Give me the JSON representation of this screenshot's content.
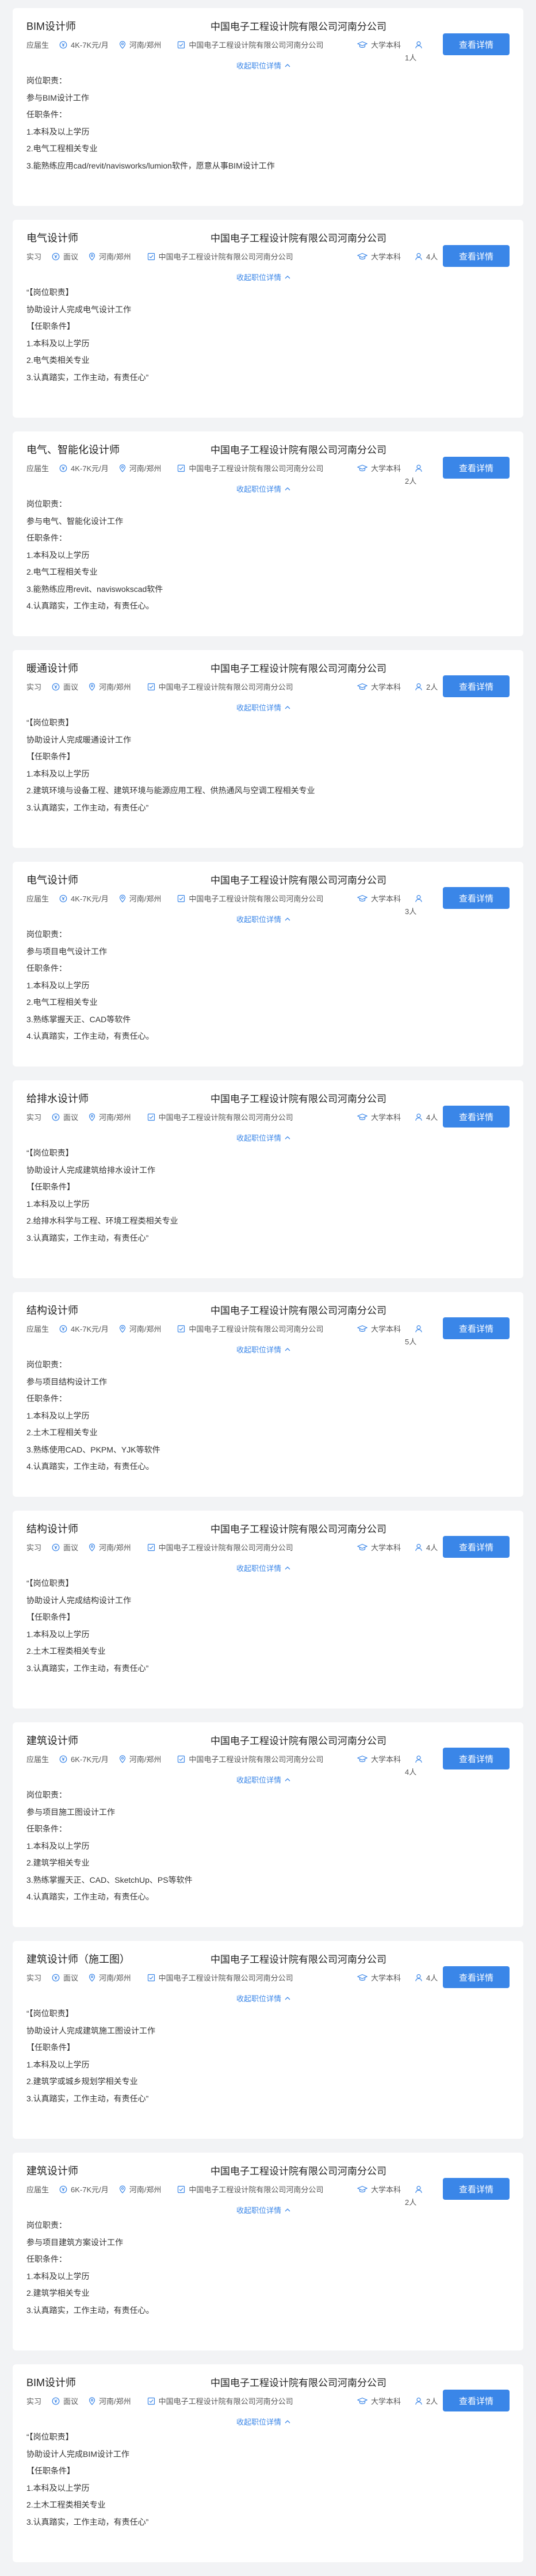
{
  "collapse_label": "收起职位详情",
  "detail_button_label": "查看详情",
  "jobs": [
    {
      "title": "BIM设计师",
      "company": "中国电子工程设计院有限公司河南分公司",
      "type": "应届生",
      "salary": "4K-7K元/月",
      "location": "河南/郑州",
      "company_short": "中国电子工程设计院有限公司河南分公司",
      "education": "大学本科",
      "headcount": "1人",
      "desc": [
        "岗位职责：",
        "参与BIM设计工作",
        "任职条件：",
        "1.本科及以上学历",
        "2.电气工程相关专业",
        "3.能熟练应用cad/revit/navisworks/lumion软件，愿意从事BIM设计工作"
      ]
    },
    {
      "title": "电气设计师",
      "company": "中国电子工程设计院有限公司河南分公司",
      "type": "实习",
      "salary": "面议",
      "location": "河南/郑州",
      "company_short": "中国电子工程设计院有限公司河南分公司",
      "education": "大学本科",
      "headcount": "4人",
      "desc": [
        "“【岗位职责】",
        "协助设计人完成电气设计工作",
        "【任职条件】",
        "1.本科及以上学历",
        "2.电气类相关专业",
        "3.认真踏实，工作主动，有责任心”"
      ]
    },
    {
      "title": "电气、智能化设计师",
      "company": "中国电子工程设计院有限公司河南分公司",
      "type": "应届生",
      "salary": "4K-7K元/月",
      "location": "河南/郑州",
      "company_short": "中国电子工程设计院有限公司河南分公司",
      "education": "大学本科",
      "headcount": "2人",
      "desc": [
        "岗位职责：",
        "参与电气、智能化设计工作",
        "任职条件：",
        "1.本科及以上学历",
        "2.电气工程相关专业",
        "3.能熟练应用revit、naviswokscad软件",
        "4.认真踏实，工作主动，有责任心。"
      ]
    },
    {
      "title": "暖通设计师",
      "company": "中国电子工程设计院有限公司河南分公司",
      "type": "实习",
      "salary": "面议",
      "location": "河南/郑州",
      "company_short": "中国电子工程设计院有限公司河南分公司",
      "education": "大学本科",
      "headcount": "2人",
      "desc": [
        "“【岗位职责】",
        "协助设计人完成暖通设计工作",
        "【任职条件】",
        "1.本科及以上学历",
        "2.建筑环境与设备工程、建筑环境与能源应用工程、供热通风与空调工程相关专业",
        "3.认真踏实，工作主动，有责任心”"
      ]
    },
    {
      "title": "电气设计师",
      "company": "中国电子工程设计院有限公司河南分公司",
      "type": "应届生",
      "salary": "4K-7K元/月",
      "location": "河南/郑州",
      "company_short": "中国电子工程设计院有限公司河南分公司",
      "education": "大学本科",
      "headcount": "3人",
      "desc": [
        "岗位职责：",
        "参与项目电气设计工作",
        "任职条件：",
        "1.本科及以上学历",
        "2.电气工程相关专业",
        "3.熟练掌握天正、CAD等软件",
        "4.认真踏实，工作主动，有责任心。"
      ]
    },
    {
      "title": "给排水设计师",
      "company": "中国电子工程设计院有限公司河南分公司",
      "type": "实习",
      "salary": "面议",
      "location": "河南/郑州",
      "company_short": "中国电子工程设计院有限公司河南分公司",
      "education": "大学本科",
      "headcount": "4人",
      "desc": [
        "“【岗位职责】",
        "协助设计人完成建筑给排水设计工作",
        "【任职条件】",
        "1.本科及以上学历",
        "2.给排水科学与工程、环境工程类相关专业",
        "3.认真踏实，工作主动，有责任心”"
      ]
    },
    {
      "title": "结构设计师",
      "company": "中国电子工程设计院有限公司河南分公司",
      "type": "应届生",
      "salary": "4K-7K元/月",
      "location": "河南/郑州",
      "company_short": "中国电子工程设计院有限公司河南分公司",
      "education": "大学本科",
      "headcount": "5人",
      "desc": [
        "岗位职责：",
        "参与项目结构设计工作",
        "任职条件：",
        "1.本科及以上学历",
        "2.土木工程相关专业",
        "3.熟练使用CAD、PKPM、YJK等软件",
        "4.认真踏实，工作主动，有责任心。"
      ]
    },
    {
      "title": "结构设计师",
      "company": "中国电子工程设计院有限公司河南分公司",
      "type": "实习",
      "salary": "面议",
      "location": "河南/郑州",
      "company_short": "中国电子工程设计院有限公司河南分公司",
      "education": "大学本科",
      "headcount": "4人",
      "desc": [
        "“【岗位职责】",
        "协助设计人完成结构设计工作",
        "【任职条件】",
        "1.本科及以上学历",
        "2.土木工程类相关专业",
        "3.认真踏实，工作主动，有责任心”"
      ]
    },
    {
      "title": "建筑设计师",
      "company": "中国电子工程设计院有限公司河南分公司",
      "type": "应届生",
      "salary": "6K-7K元/月",
      "location": "河南/郑州",
      "company_short": "中国电子工程设计院有限公司河南分公司",
      "education": "大学本科",
      "headcount": "4人",
      "desc": [
        "岗位职责：",
        "参与项目施工图设计工作",
        "任职条件：",
        "1.本科及以上学历",
        "2.建筑学相关专业",
        "3.熟练掌握天正、CAD、SketchUp、PS等软件",
        "4.认真踏实，工作主动，有责任心。"
      ]
    },
    {
      "title": "建筑设计师（施工图）",
      "company": "中国电子工程设计院有限公司河南分公司",
      "type": "实习",
      "salary": "面议",
      "location": "河南/郑州",
      "company_short": "中国电子工程设计院有限公司河南分公司",
      "education": "大学本科",
      "headcount": "4人",
      "desc": [
        "“【岗位职责】",
        "协助设计人完成建筑施工图设计工作",
        "【任职条件】",
        "1.本科及以上学历",
        "2.建筑学或城乡规划学相关专业",
        "3.认真踏实，工作主动，有责任心”"
      ]
    },
    {
      "title": "建筑设计师",
      "company": "中国电子工程设计院有限公司河南分公司",
      "type": "应届生",
      "salary": "6K-7K元/月",
      "location": "河南/郑州",
      "company_short": "中国电子工程设计院有限公司河南分公司",
      "education": "大学本科",
      "headcount": "2人",
      "desc": [
        "岗位职责：",
        "参与项目建筑方案设计工作",
        "任职条件：",
        "1.本科及以上学历",
        "2.建筑学相关专业",
        "3.认真踏实，工作主动，有责任心。"
      ]
    },
    {
      "title": "BIM设计师",
      "company": "中国电子工程设计院有限公司河南分公司",
      "type": "实习",
      "salary": "面议",
      "location": "河南/郑州",
      "company_short": "中国电子工程设计院有限公司河南分公司",
      "education": "大学本科",
      "headcount": "2人",
      "desc": [
        "“【岗位职责】",
        "协助设计人完成BIM设计工作",
        "【任职条件】",
        "1.本科及以上学历",
        "2.土木工程类相关专业",
        "3.认真踏实，工作主动，有责任心”"
      ]
    }
  ]
}
